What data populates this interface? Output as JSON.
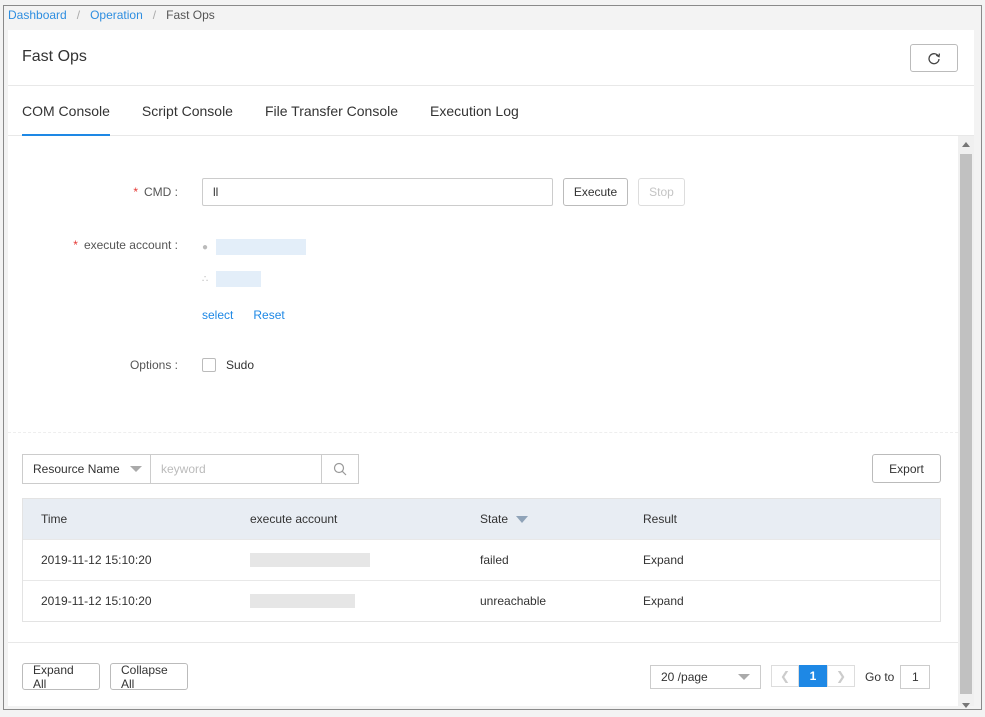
{
  "breadcrumb": [
    "Dashboard",
    "Operation",
    "Fast Ops"
  ],
  "header": {
    "title": "Fast Ops"
  },
  "tabs": [
    {
      "label": "COM Console",
      "active": true
    },
    {
      "label": "Script Console",
      "active": false
    },
    {
      "label": "File Transfer Console",
      "active": false
    },
    {
      "label": "Execution Log",
      "active": false
    }
  ],
  "form": {
    "cmd_label": "CMD :",
    "cmd_value": "ll",
    "execute_label": "Execute",
    "stop_label": "Stop",
    "account_label": "execute account :",
    "select_label": "select",
    "reset_label": "Reset",
    "options_label": "Options :",
    "sudo_label": "Sudo"
  },
  "search": {
    "field_select": "Resource Name",
    "placeholder": "keyword",
    "export_label": "Export"
  },
  "table": {
    "headers": [
      "Time",
      "execute account",
      "State",
      "Result"
    ],
    "rows": [
      {
        "time": "2019-11-12 15:10:20",
        "state": "failed",
        "result": "Expand"
      },
      {
        "time": "2019-11-12 15:10:20",
        "state": "unreachable",
        "result": "Expand"
      }
    ]
  },
  "footer": {
    "expand_all": "Expand All",
    "collapse_all": "Collapse All",
    "page_size": "20 /page",
    "current_page": "1",
    "goto_label": "Go to",
    "goto_value": "1"
  },
  "colors": {
    "accent": "#1e88e5",
    "required": "#e53935",
    "table_header": "#e8edf3"
  }
}
